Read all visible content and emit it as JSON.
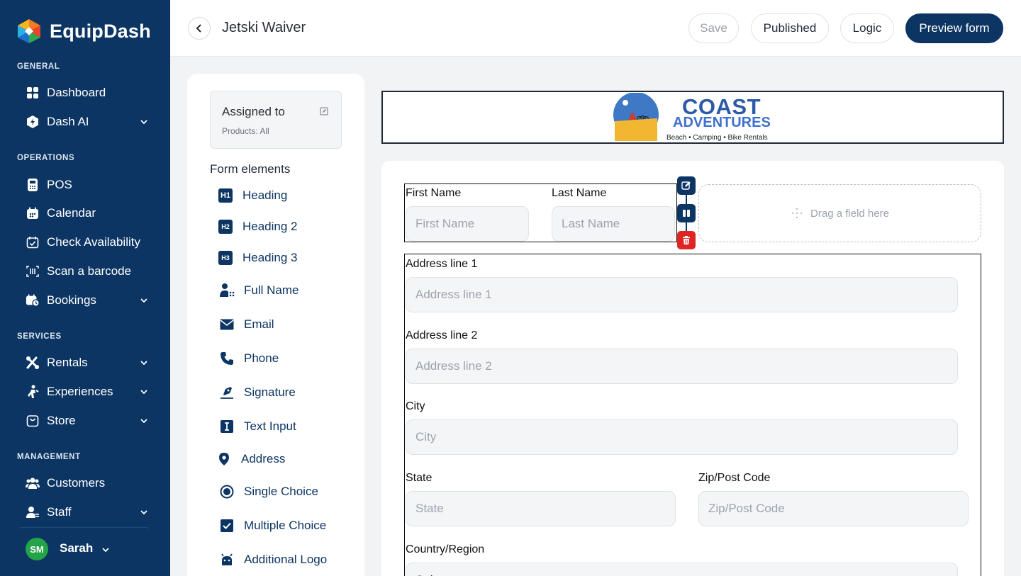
{
  "app": {
    "name": "EquipDash"
  },
  "sidebar": {
    "sections": {
      "general": "GENERAL",
      "operations": "OPERATIONS",
      "services": "SERVICES",
      "management": "MANAGEMENT"
    },
    "items": {
      "dashboard": "Dashboard",
      "dash_ai": "Dash AI",
      "pos": "POS",
      "calendar": "Calendar",
      "check_availability": "Check Availability",
      "scan_barcode": "Scan a barcode",
      "bookings": "Bookings",
      "rentals": "Rentals",
      "experiences": "Experiences",
      "store": "Store",
      "customers": "Customers",
      "staff": "Staff"
    },
    "user": {
      "initials": "SM",
      "name": "Sarah"
    }
  },
  "header": {
    "title": "Jetski Waiver",
    "save": "Save",
    "published": "Published",
    "logic": "Logic",
    "preview": "Preview form"
  },
  "elements_panel": {
    "assigned_title": "Assigned to",
    "assigned_sub": "Products: All",
    "title": "Form elements",
    "items": {
      "heading": "Heading",
      "heading2": "Heading 2",
      "heading3": "Heading 3",
      "full_name": "Full Name",
      "email": "Email",
      "phone": "Phone",
      "signature": "Signature",
      "text_input": "Text Input",
      "address": "Address",
      "single_choice": "Single Choice",
      "multiple_choice": "Multiple Choice",
      "additional_logo": "Additional Logo"
    },
    "badges": {
      "h1": "H1",
      "h2": "H2",
      "h3": "H3"
    }
  },
  "logo": {
    "line1": "COAST",
    "line2": "ADVENTURES",
    "tagline": "Beach • Camping • Bike Rentals"
  },
  "form": {
    "first_name": {
      "label": "First Name",
      "placeholder": "First Name"
    },
    "last_name": {
      "label": "Last Name",
      "placeholder": "Last Name"
    },
    "dropzone": "Drag a field here",
    "address1": {
      "label": "Address line 1",
      "placeholder": "Address line 1"
    },
    "address2": {
      "label": "Address line 2",
      "placeholder": "Address line 2"
    },
    "city": {
      "label": "City",
      "placeholder": "City"
    },
    "state": {
      "label": "State",
      "placeholder": "State"
    },
    "zip": {
      "label": "Zip/Post Code",
      "placeholder": "Zip/Post Code"
    },
    "country": {
      "label": "Country/Region",
      "placeholder": "Select"
    }
  },
  "colors": {
    "primary": "#0c3563",
    "danger": "#e02424",
    "avatar": "#22a447"
  }
}
